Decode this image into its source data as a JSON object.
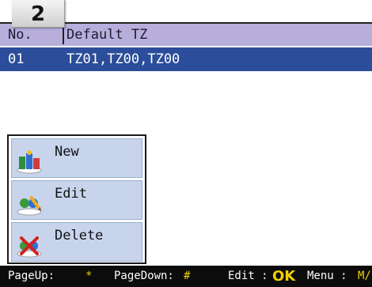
{
  "step_badge": "2",
  "table": {
    "headers": {
      "no": "No.",
      "tz": "Default TZ"
    },
    "rows": [
      {
        "no": "01",
        "tz": "TZ01,TZ00,TZ00"
      }
    ]
  },
  "menu": {
    "items": [
      {
        "label": "New",
        "icon": "new-icon"
      },
      {
        "label": "Edit",
        "icon": "edit-icon"
      },
      {
        "label": "Delete",
        "icon": "delete-icon"
      }
    ]
  },
  "footer": {
    "pageup_label": "PageUp:",
    "pageup_key": "*",
    "pagedown_label": "PageDown:",
    "pagedown_key": "#",
    "edit_label": "Edit :",
    "edit_key": "OK",
    "menu_label": "Menu :",
    "menu_key": "M/"
  },
  "colors": {
    "header_bg": "#b8aedc",
    "selected_row_bg": "#2b4d9a",
    "menu_item_bg": "#c7d4ec",
    "footer_bg": "#0c0c0c",
    "footer_key": "#f0d000"
  }
}
